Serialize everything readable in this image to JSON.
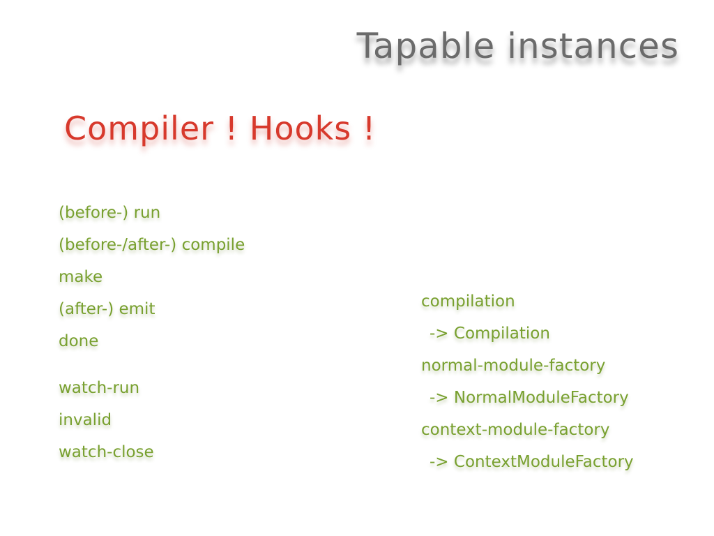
{
  "slide": {
    "title": "Tapable instances",
    "subtitle": "Compiler ! Hooks !",
    "left_list_1": [
      "(before-) run",
      "(before-/after-) compile",
      "make",
      "(after-) emit",
      "done"
    ],
    "left_list_2": [
      "watch-run",
      "invalid",
      "watch-close"
    ],
    "right_list": [
      "compilation",
      "-> Compilation",
      "normal-module-factory",
      "-> NormalModuleFactory",
      "context-module-factory",
      "-> ContextModuleFactory"
    ],
    "colors": {
      "title": "#6b6b6b",
      "subtitle": "#d7392c",
      "list": "#78a02f"
    }
  }
}
